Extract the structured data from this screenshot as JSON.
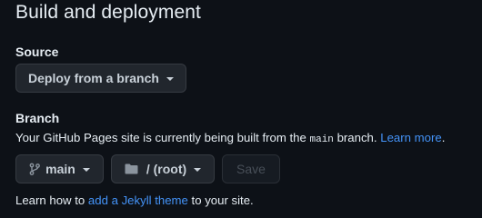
{
  "section": {
    "title": "Build and deployment"
  },
  "source": {
    "label": "Source",
    "dropdown_value": "Deploy from a branch"
  },
  "branch": {
    "label": "Branch",
    "description_prefix": "Your GitHub Pages site is currently being built from the ",
    "branch_code": "main",
    "description_suffix": " branch. ",
    "learn_more_link": "Learn more",
    "period": ".",
    "branch_dropdown": "main",
    "folder_dropdown": "/ (root)",
    "save_button": "Save"
  },
  "footer": {
    "prefix": "Learn how to ",
    "jekyll_link": "add a Jekyll theme",
    "suffix": " to your site."
  },
  "colors": {
    "background": "#0d1117",
    "link": "#4493f8",
    "button_bg": "#21262d"
  },
  "icons": {
    "branch": "git-branch-icon",
    "folder": "folder-icon",
    "caret": "triangle-down-icon"
  }
}
